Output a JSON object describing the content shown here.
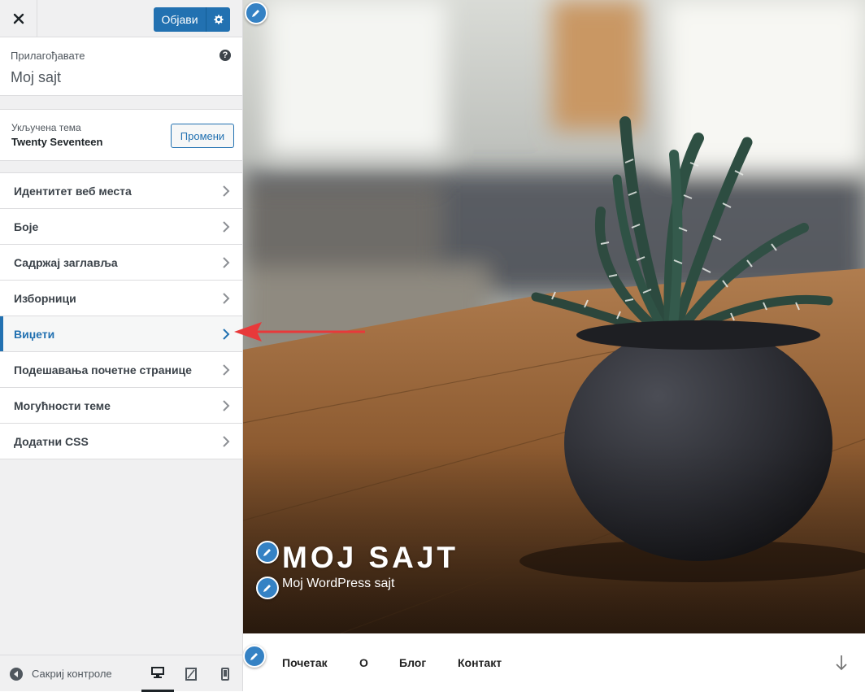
{
  "header": {
    "close_icon": "close-icon",
    "publish_label": "Објави",
    "publish_settings_icon": "gear-icon"
  },
  "customize_info": {
    "action_label": "Прилагођавате",
    "site_name": "Moj sajt",
    "help_icon": "help-icon"
  },
  "theme": {
    "label": "Укључена тема",
    "name": "Twenty Seventeen",
    "change_label": "Промени"
  },
  "menu": {
    "items": [
      {
        "label": "Идентитет веб места"
      },
      {
        "label": "Боје"
      },
      {
        "label": "Садржај заглавља"
      },
      {
        "label": "Изборници"
      },
      {
        "label": "Виџети",
        "active": true
      },
      {
        "label": "Подешавања почетне странице"
      },
      {
        "label": "Могућности теме"
      },
      {
        "label": "Додатни CSS"
      }
    ]
  },
  "footer": {
    "collapse_label": "Сакриј контроле",
    "devices": [
      "desktop",
      "tablet",
      "mobile"
    ],
    "active_device": "desktop"
  },
  "preview": {
    "site_title": "MOJ SAJT",
    "site_description": "Moj WordPress sajt",
    "nav": [
      "Почетак",
      "О",
      "Блог",
      "Контакт"
    ]
  },
  "colors": {
    "accent": "#2271b1",
    "annotation_arrow": "#e8393a"
  }
}
